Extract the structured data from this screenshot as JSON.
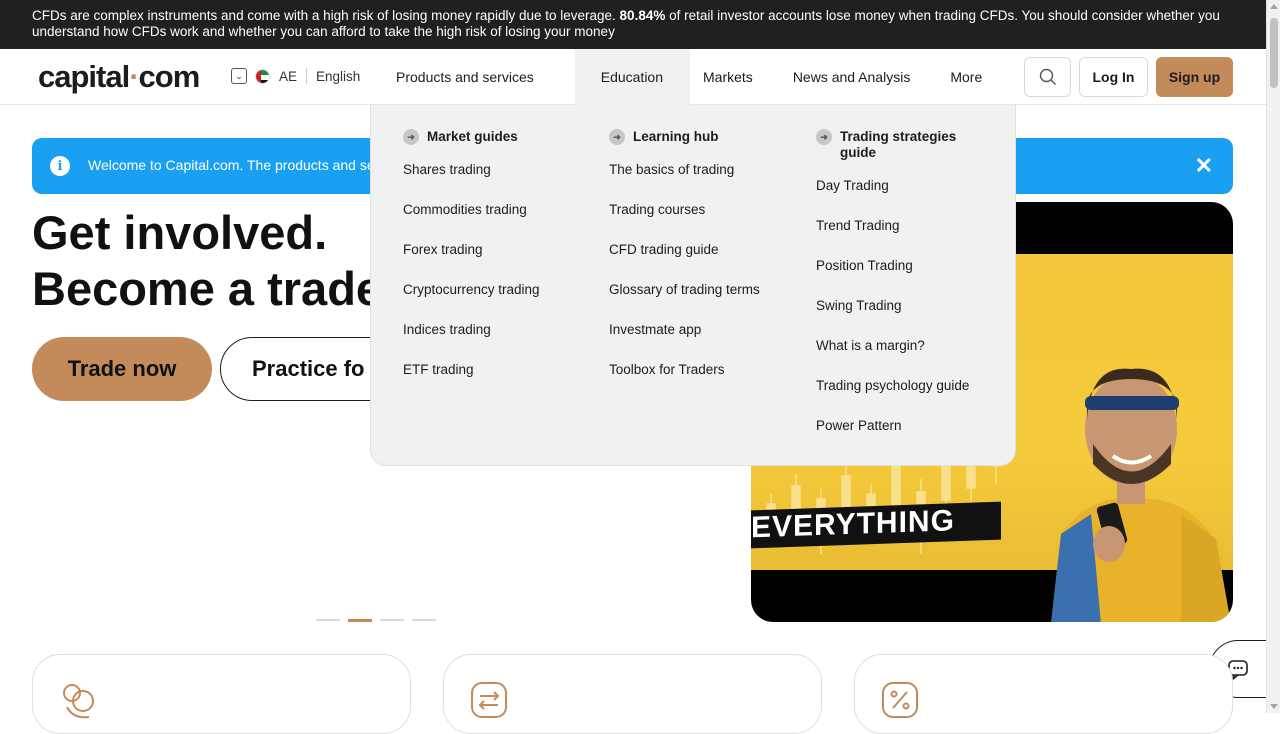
{
  "risk_warning": {
    "text_before": "CFDs are complex instruments and come with a high risk of losing money rapidly due to leverage.",
    "percent": "80.84%",
    "text_after": "of retail investor accounts lose money when trading CFDs. You should consider whether you understand how CFDs work and whether you can afford to take the high risk of losing your money"
  },
  "header": {
    "logo_main": "capital",
    "logo_dot": "·",
    "logo_tail": "com",
    "region": "AE",
    "language": "English",
    "nav": [
      "Products and services",
      "Education",
      "Markets",
      "News and Analysis",
      "More"
    ],
    "active_nav": "Education",
    "login": "Log In",
    "signup": "Sign up"
  },
  "welcome": {
    "text": "Welcome to Capital.com. The products and serv"
  },
  "hero": {
    "line1": "Get involved.",
    "line2": "Become a trade",
    "trade_now": "Trade now",
    "practice": "Practice fo"
  },
  "video": {
    "banner_text": "EVERYTHING"
  },
  "mega_menu": {
    "columns": [
      {
        "heading": "Market guides",
        "links": [
          "Shares trading",
          "Commodities trading",
          "Forex trading",
          "Cryptocurrency trading",
          "Indices trading",
          "ETF trading"
        ]
      },
      {
        "heading": "Learning hub",
        "links": [
          "The basics of trading",
          "Trading courses",
          "CFD trading guide",
          "Glossary of trading terms",
          "Investmate app",
          "Toolbox for Traders"
        ]
      },
      {
        "heading": "Trading strategies guide",
        "links": [
          "Day Trading",
          "Trend Trading",
          "Position Trading",
          "Swing Trading",
          "What is a margin?",
          "Trading psychology guide",
          "Power Pattern"
        ]
      }
    ]
  },
  "colors": {
    "accent": "#c48b5a",
    "info_blue": "#1aa0f2",
    "dark_bar": "#1f2020",
    "menu_bg": "#f1f1f2"
  },
  "slider": {
    "total": 4,
    "active": 2
  }
}
